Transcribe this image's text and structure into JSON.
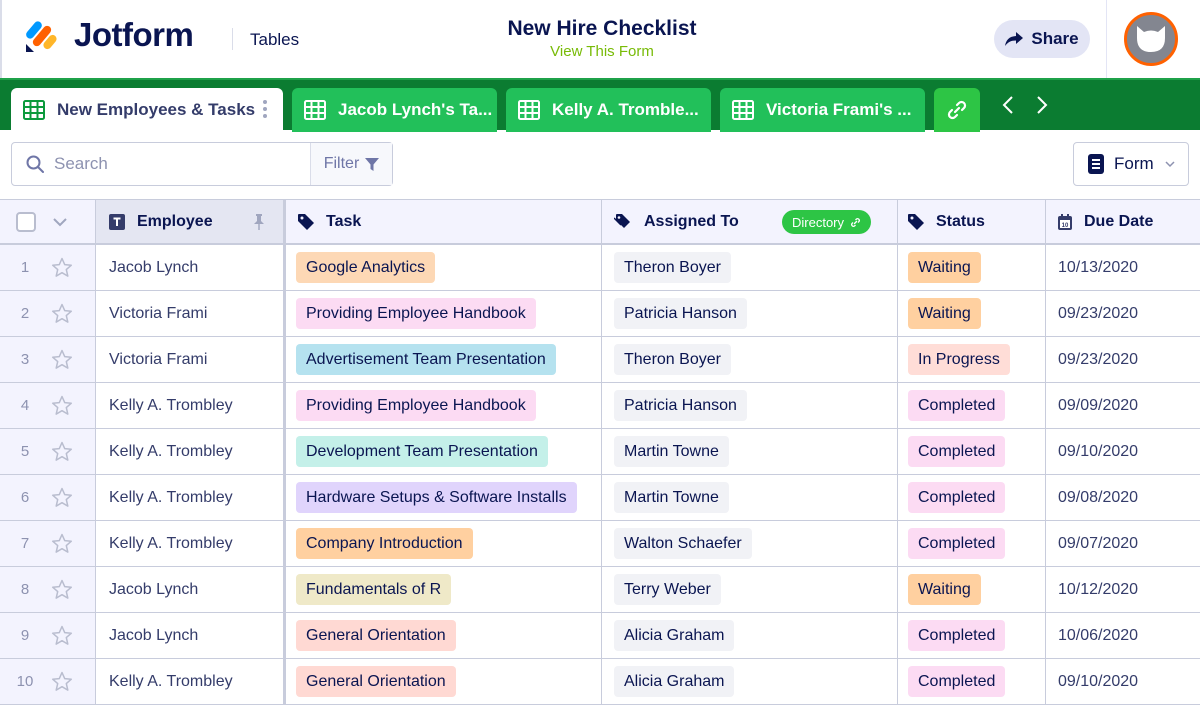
{
  "header": {
    "brand": "Jotform",
    "product": "Tables",
    "title": "New Hire Checklist",
    "subtitle": "View This Form",
    "share_label": "Share"
  },
  "tabs": [
    {
      "label": "New Employees & Tasks",
      "active": true
    },
    {
      "label": "Jacob Lynch's Ta...",
      "active": false
    },
    {
      "label": "Kelly A. Tromble...",
      "active": false
    },
    {
      "label": "Victoria Frami's ...",
      "active": false
    }
  ],
  "toolbar": {
    "search_placeholder": "Search",
    "filter_label": "Filter",
    "form_label": "Form"
  },
  "columns": {
    "employee": "Employee",
    "task": "Task",
    "assigned": "Assigned To",
    "directory": "Directory",
    "status": "Status",
    "due": "Due Date"
  },
  "colors": {
    "brand_navy": "#0a1551",
    "tab_bar": "#0b7c31",
    "tab": "#22c05a",
    "link_green": "#78bb07",
    "status_waiting": "#ffd0a0",
    "status_in_progress": "#ffddd7",
    "status_completed": "#fcdbf3"
  },
  "rows": [
    {
      "num": "1",
      "employee": "Jacob Lynch",
      "task": "Google Analytics",
      "task_color": "#fdd8b5",
      "assigned": "Theron Boyer",
      "status": "Waiting",
      "status_color": "#ffd0a0",
      "due": "10/13/2020"
    },
    {
      "num": "2",
      "employee": "Victoria Frami",
      "task": "Providing Employee Handbook",
      "task_color": "#fcdbf3",
      "assigned": "Patricia Hanson",
      "status": "Waiting",
      "status_color": "#ffd0a0",
      "due": "09/23/2020"
    },
    {
      "num": "3",
      "employee": "Victoria Frami",
      "task": "Advertisement Team Presentation",
      "task_color": "#b5e2ef",
      "assigned": "Theron Boyer",
      "status": "In Progress",
      "status_color": "#ffddd7",
      "due": "09/23/2020"
    },
    {
      "num": "4",
      "employee": "Kelly A. Trombley",
      "task": "Providing Employee Handbook",
      "task_color": "#fcdbf3",
      "assigned": "Patricia Hanson",
      "status": "Completed",
      "status_color": "#fcdbf3",
      "due": "09/09/2020"
    },
    {
      "num": "5",
      "employee": "Kelly A. Trombley",
      "task": "Development Team Presentation",
      "task_color": "#c4f0e9",
      "assigned": "Martin Towne",
      "status": "Completed",
      "status_color": "#fcdbf3",
      "due": "09/10/2020"
    },
    {
      "num": "6",
      "employee": "Kelly A. Trombley",
      "task": "Hardware Setups & Software Installs",
      "task_color": "#e0d4fc",
      "assigned": "Martin Towne",
      "status": "Completed",
      "status_color": "#fcdbf3",
      "due": "09/08/2020"
    },
    {
      "num": "7",
      "employee": "Kelly A. Trombley",
      "task": "Company Introduction",
      "task_color": "#ffd0a0",
      "assigned": "Walton Schaefer",
      "status": "Completed",
      "status_color": "#fcdbf3",
      "due": "09/07/2020"
    },
    {
      "num": "8",
      "employee": "Jacob Lynch",
      "task": "Fundamentals of R",
      "task_color": "#efe9c8",
      "assigned": "Terry Weber",
      "status": "Waiting",
      "status_color": "#ffd0a0",
      "due": "10/12/2020"
    },
    {
      "num": "9",
      "employee": "Jacob Lynch",
      "task": "General Orientation",
      "task_color": "#ffd9d3",
      "assigned": "Alicia Graham",
      "status": "Completed",
      "status_color": "#fcdbf3",
      "due": "10/06/2020"
    },
    {
      "num": "10",
      "employee": "Kelly A. Trombley",
      "task": "General Orientation",
      "task_color": "#ffd9d3",
      "assigned": "Alicia Graham",
      "status": "Completed",
      "status_color": "#fcdbf3",
      "due": "09/10/2020"
    }
  ]
}
